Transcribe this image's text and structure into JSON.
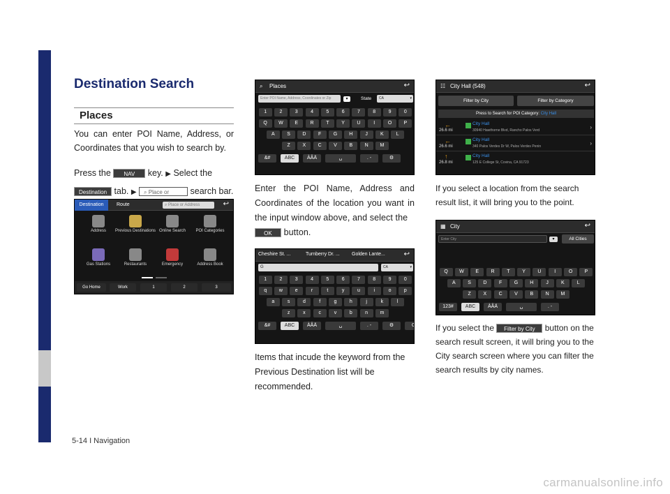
{
  "heading": "Destination Search",
  "subheading": "Places",
  "left": {
    "p1": "You can enter POI Name, Address, or Coordinates that you wish to search by.",
    "p2_press": "Press the",
    "p2_nav": "NAV",
    "p2_key": "key.",
    "p2_select": "Select the",
    "p2_dest": "Destination",
    "p2_tab": "tab.",
    "p2_place": "Place or Address",
    "p2_bar": "search bar."
  },
  "mid": {
    "p1": "Enter the POI Name, Address and Coordinates of the location you want in the input window above, and select the",
    "ok": "OK",
    "p1_end": "button.",
    "p2": "Items that incude the keyword from the Previous Destination list will be recommended."
  },
  "right": {
    "p1": "If you select a location from the search result list, it will bring you to the point.",
    "p2_a": "If you select the",
    "p2_btn": "Filter by City",
    "p2_b": "button on the search result screen, it will bring you to the City search screen where you can filter the search results by city names."
  },
  "shot_menu": {
    "tabs": [
      "Destination",
      "Route"
    ],
    "search": "Place or Address",
    "items": [
      "Address",
      "Previous Destinations",
      "Online Search",
      "POI Categories",
      "Gas Stations",
      "Restaurants",
      "Emergency",
      "Address Book"
    ],
    "bottom": [
      "Go Home",
      "Work",
      "1",
      "2",
      "3"
    ]
  },
  "shot_places": {
    "title": "Places",
    "input": "Enter POI Name, Address, Coordinates or Zip",
    "state_label": "State",
    "state": "CA",
    "rows": [
      [
        "1",
        "2",
        "3",
        "4",
        "5",
        "6",
        "7",
        "8",
        "9",
        "0"
      ],
      [
        "Q",
        "W",
        "E",
        "R",
        "T",
        "Y",
        "U",
        "I",
        "O",
        "P"
      ],
      [
        "A",
        "S",
        "D",
        "F",
        "G",
        "H",
        "J",
        "K",
        "L"
      ],
      [
        "Z",
        "X",
        "C",
        "V",
        "B",
        "N",
        "M"
      ]
    ],
    "bottom": [
      "&#",
      "ABC",
      "ÀÂÄ",
      "␣",
      ". -",
      "⚙"
    ]
  },
  "shot_places2": {
    "recents": [
      "Cheshire St. ...",
      "Turnberry Dr. ...",
      "Golden Lante..."
    ],
    "input": "G",
    "state": "CA",
    "rows": [
      [
        "1",
        "2",
        "3",
        "4",
        "5",
        "6",
        "7",
        "8",
        "9",
        "0"
      ],
      [
        "q",
        "w",
        "e",
        "r",
        "t",
        "y",
        "u",
        "i",
        "o",
        "p"
      ],
      [
        "a",
        "s",
        "d",
        "f",
        "g",
        "h",
        "j",
        "k",
        "l"
      ],
      [
        "z",
        "x",
        "c",
        "v",
        "b",
        "n",
        "m"
      ]
    ],
    "bottom": [
      "&#",
      "ABC",
      "ÀÂÄ",
      "␣",
      ". -",
      "⚙",
      "OK"
    ]
  },
  "shot_results": {
    "title": "City Hall (548)",
    "filter_city": "Filter by City",
    "filter_cat": "Filter by Category",
    "press": "Press to Search for POI Category:",
    "press_val": "City Hall",
    "items": [
      {
        "dist": "26.6 mi",
        "name": "City Hall",
        "addr": "30940 Hawthorne Blvd, Rancho Palos Verd"
      },
      {
        "dist": "26.6 mi",
        "name": "City Hall",
        "addr": "340 Palos Verdes Dr W, Palos Verdes Penin"
      },
      {
        "dist": "26.8 mi",
        "name": "City Hall",
        "addr": "125 E College St, Covina, CA 91723"
      }
    ]
  },
  "shot_city": {
    "title": "City",
    "input": "Enter City",
    "all": "All Cities",
    "rows": [
      [
        "Q",
        "W",
        "E",
        "R",
        "T",
        "Y",
        "U",
        "I",
        "O",
        "P"
      ],
      [
        "A",
        "S",
        "D",
        "F",
        "G",
        "H",
        "J",
        "K",
        "L"
      ],
      [
        "Z",
        "X",
        "C",
        "V",
        "B",
        "N",
        "M"
      ]
    ],
    "bottom": [
      "123#",
      "ABC",
      "ÀÂÄ",
      "␣",
      ". -"
    ]
  },
  "footer": "5-14 I Navigation",
  "watermark": "carmanualsonline.info"
}
